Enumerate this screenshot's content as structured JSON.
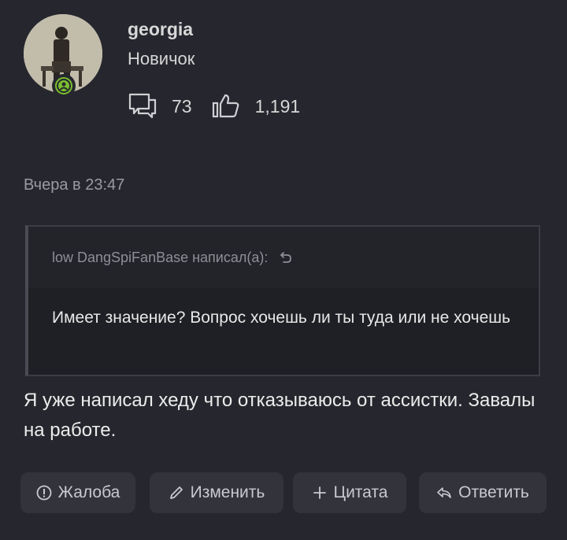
{
  "post": {
    "author": "georgia",
    "user_title": "Новичок",
    "messages_count": "73",
    "reactions_count": "1,191",
    "date": "Вчера в 23:47"
  },
  "quote": {
    "author_line": "low DangSpiFanBase написал(а):",
    "text": "Имеет значение? Вопрос хочешь ли ты туда или не хочешь"
  },
  "message": {
    "text": "Я уже написал хеду что отказываюсь от ассистки. Завалы на работе."
  },
  "actions": {
    "report": "Жалоба",
    "edit": "Изменить",
    "quote": "Цитата",
    "reply": "Ответить"
  },
  "colors": {
    "background": "#26272e",
    "online": "#7bc02f",
    "button_bg": "#32333b"
  },
  "icons": {
    "messages": "speech-bubbles-icon",
    "reactions": "thumbs-up-icon",
    "online": "user-online-icon",
    "quote_jump": "go-to-quote-icon",
    "report": "report-icon",
    "edit": "pencil-icon",
    "quote": "plus-icon",
    "reply": "reply-icon"
  }
}
